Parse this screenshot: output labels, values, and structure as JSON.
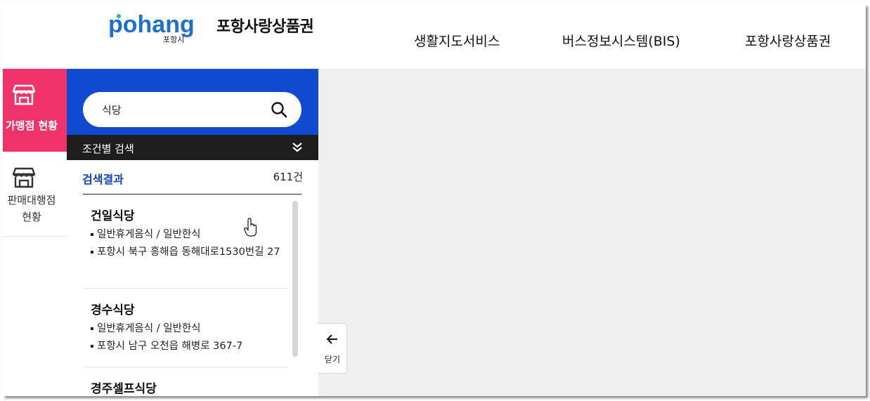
{
  "header": {
    "logo_text": "pohang",
    "logo_sub": "포항시",
    "brand_title": "포항사랑상품권",
    "nav": [
      "생활지도서비스",
      "버스정보시스템(BIS)",
      "포항사랑상품권"
    ]
  },
  "rail": {
    "items": [
      {
        "label": "가맹점 현황",
        "icon": "store-icon",
        "active": true
      },
      {
        "label_line1": "판매대행점",
        "label_line2": "현황",
        "icon": "store-icon",
        "active": false
      }
    ]
  },
  "search": {
    "value": "식당",
    "condition_label": "조건별 검색"
  },
  "results": {
    "title": "검색결과",
    "count": "611건",
    "items": [
      {
        "name": "건일식당",
        "category": "일반휴게음식 / 일반한식",
        "address": "포항시 북구 흥해읍 동해대로1530번길 27"
      },
      {
        "name": "경수식당",
        "category": "일반휴게음식 / 일반한식",
        "address": "포항시 남구 오천읍 해병로 367-7"
      },
      {
        "name": "경주셀프식당",
        "category": "",
        "address": ""
      }
    ]
  },
  "panel_toggle": {
    "label": "닫기"
  },
  "colors": {
    "accent_pink": "#f1336b",
    "search_blue": "#0f4bd1",
    "result_title_blue": "#1642b8"
  }
}
